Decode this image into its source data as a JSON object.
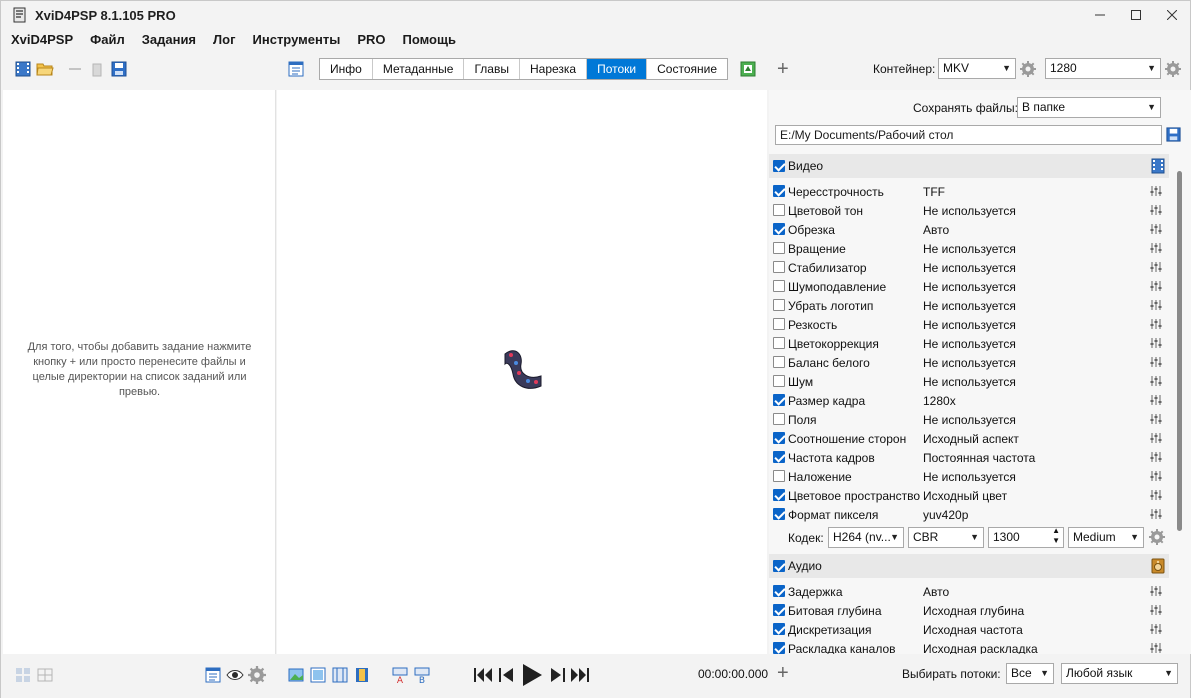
{
  "window": {
    "title": "XviD4PSP 8.1.105 PRO"
  },
  "menu": [
    "XviD4PSP",
    "Файл",
    "Задания",
    "Лог",
    "Инструменты",
    "PRO",
    "Помощь"
  ],
  "tabs": {
    "items": [
      "Инфо",
      "Метаданные",
      "Главы",
      "Нарезка",
      "Потоки",
      "Состояние"
    ],
    "active": "Потоки"
  },
  "container": {
    "label": "Контейнер:",
    "value": "MKV",
    "resolution": "1280"
  },
  "left_panel": {
    "hint": "Для того, чтобы добавить задание нажмите кнопку + или просто перенесите файлы и целые директории на список заданий или превью."
  },
  "save": {
    "label": "Сохранять файлы:",
    "mode": "В папке",
    "path": "E:/My Documents/Рабочий стол"
  },
  "video": {
    "title": "Видео",
    "checked": true,
    "filters": [
      {
        "name": "Чересстрочность",
        "value": "TFF",
        "on": true
      },
      {
        "name": "Цветовой тон",
        "value": "Не используется",
        "on": false
      },
      {
        "name": "Обрезка",
        "value": "Авто",
        "on": true
      },
      {
        "name": "Вращение",
        "value": "Не используется",
        "on": false
      },
      {
        "name": "Стабилизатор",
        "value": "Не используется",
        "on": false
      },
      {
        "name": "Шумоподавление",
        "value": "Не используется",
        "on": false
      },
      {
        "name": "Убрать логотип",
        "value": "Не используется",
        "on": false
      },
      {
        "name": "Резкость",
        "value": "Не используется",
        "on": false
      },
      {
        "name": "Цветокоррекция",
        "value": "Не используется",
        "on": false
      },
      {
        "name": "Баланс белого",
        "value": "Не используется",
        "on": false
      },
      {
        "name": "Шум",
        "value": "Не используется",
        "on": false
      },
      {
        "name": "Размер кадра",
        "value": "1280x",
        "on": true
      },
      {
        "name": "Поля",
        "value": "Не используется",
        "on": false
      },
      {
        "name": "Соотношение сторон",
        "value": "Исходный аспект",
        "on": true
      },
      {
        "name": "Частота кадров",
        "value": "Постоянная частота",
        "on": true
      },
      {
        "name": "Наложение",
        "value": "Не используется",
        "on": false
      },
      {
        "name": "Цветовое пространство",
        "value": "Исходный цвет",
        "on": true
      },
      {
        "name": "Формат пикселя",
        "value": "yuv420p",
        "on": true
      }
    ],
    "codec": {
      "label": "Кодек:",
      "codec": "H264 (nv...",
      "mode": "CBR",
      "bitrate": "1300",
      "preset": "Medium"
    }
  },
  "audio": {
    "title": "Аудио",
    "checked": true,
    "filters": [
      {
        "name": "Задержка",
        "value": "Авто",
        "on": true
      },
      {
        "name": "Битовая глубина",
        "value": "Исходная глубина",
        "on": true
      },
      {
        "name": "Дискретизация",
        "value": "Исходная частота",
        "on": true
      },
      {
        "name": "Раскладка каналов",
        "value": "Исходная раскладка",
        "on": true
      }
    ]
  },
  "bottom": {
    "time": "00:00:00.000",
    "streams_label": "Выбирать потоки:",
    "streams_value": "Все",
    "language_value": "Любой язык"
  }
}
